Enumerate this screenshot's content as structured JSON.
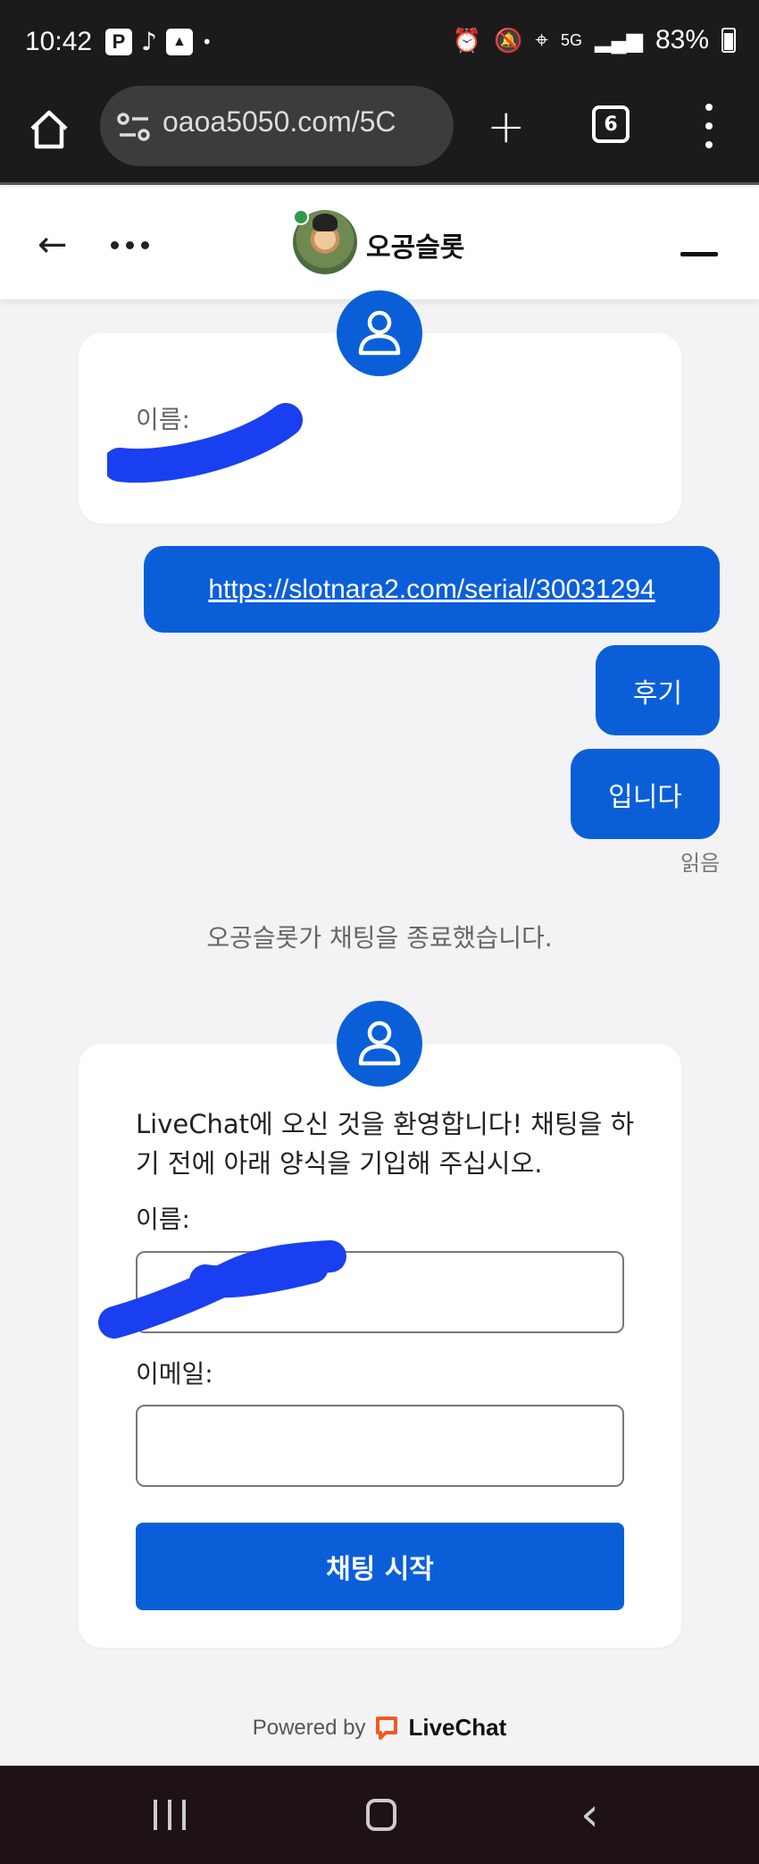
{
  "status_bar": {
    "time": "10:42",
    "battery": "83%",
    "network": "5G",
    "left_icons": [
      "P",
      "tiktok-icon",
      "gallery-icon",
      "•"
    ]
  },
  "browser": {
    "url": "oaoa5050.com/5C",
    "tab_count": "6"
  },
  "chat_header": {
    "agent_name": "오공슬롯"
  },
  "prechat_card": {
    "name_label": "이름:"
  },
  "messages": [
    {
      "text": "https://slotnara2.com/serial/30031294",
      "type": "link"
    },
    {
      "text": "후기",
      "type": "text"
    },
    {
      "text": "입니다",
      "type": "text"
    }
  ],
  "read_status": "읽음",
  "system_message": "오공슬롯가 채팅을 종료했습니다.",
  "form": {
    "welcome_text": "LiveChat에 오신 것을 환영합니다! 채팅을 하기 전에 아래 양식을 기입해 주십시오.",
    "name_label": "이름:",
    "email_label": "이메일:",
    "start_button": "채팅 시작"
  },
  "footer": {
    "powered_by": "Powered by",
    "brand": "LiveChat"
  },
  "colors": {
    "accent": "#0a5fd9",
    "background": "#f3f3f5",
    "scribble": "#1a3ff0"
  }
}
